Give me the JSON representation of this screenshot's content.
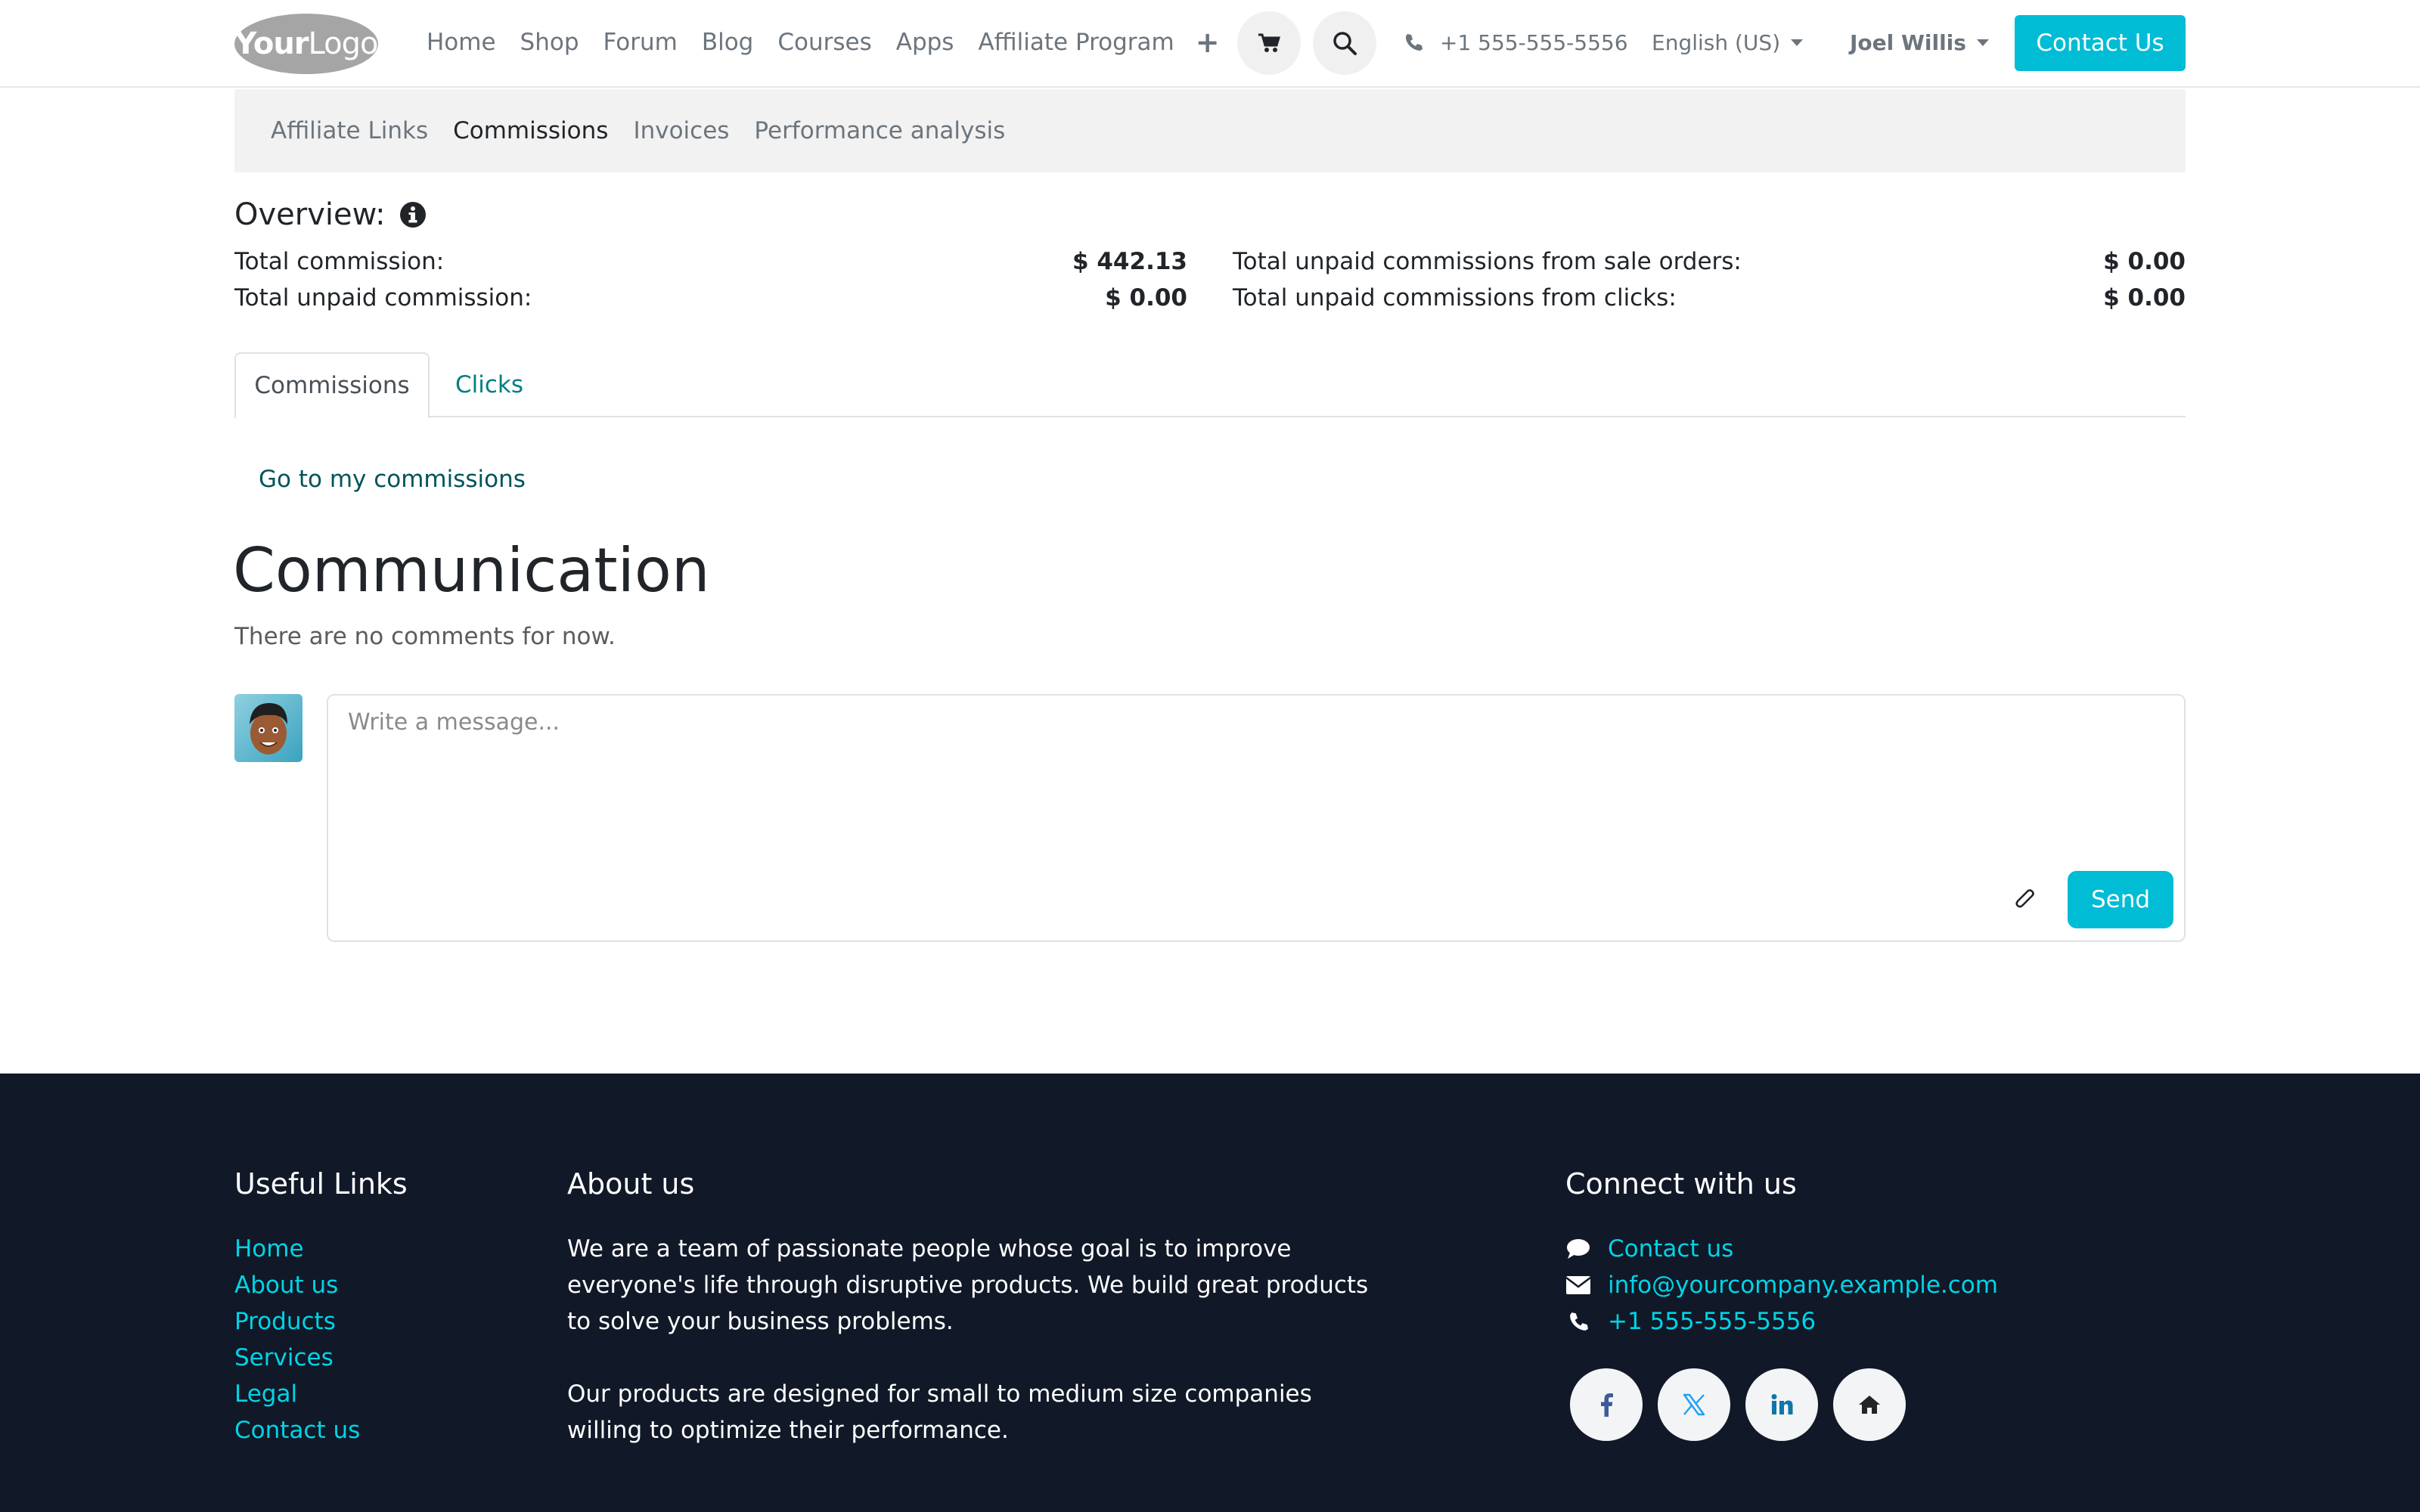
{
  "header": {
    "logo": {
      "part1": "Your",
      "part2": "Logo"
    },
    "nav": [
      "Home",
      "Shop",
      "Forum",
      "Blog",
      "Courses",
      "Apps",
      "Affiliate Program"
    ],
    "phone": "+1 555-555-5556",
    "language": "English (US)",
    "user": "Joel Willis",
    "contact_button": "Contact Us"
  },
  "subnav": [
    "Affiliate Links",
    "Commissions",
    "Invoices",
    "Performance analysis"
  ],
  "overview": {
    "title": "Overview:",
    "rows": [
      {
        "label": "Total commission:",
        "value": "$ 442.13"
      },
      {
        "label": "Total unpaid commission:",
        "value": "$ 0.00"
      },
      {
        "label": "Total unpaid commissions from sale orders:",
        "value": "$ 0.00"
      },
      {
        "label": "Total unpaid commissions from clicks:",
        "value": "$ 0.00"
      }
    ]
  },
  "tabs": {
    "commissions": "Commissions",
    "clicks": "Clicks"
  },
  "go_link": "Go to my commissions",
  "communication": {
    "title": "Communication",
    "empty": "There are no comments for now.",
    "placeholder": "Write a message...",
    "send": "Send"
  },
  "footer": {
    "useful_links": {
      "title": "Useful Links",
      "items": [
        "Home",
        "About us",
        "Products",
        "Services",
        "Legal",
        "Contact us"
      ]
    },
    "about": {
      "title": "About us",
      "p1": "We are a team of passionate people whose goal is to improve everyone's life through disruptive products. We build great products to solve your business problems.",
      "p2": "Our products are designed for small to medium size companies willing to optimize their performance."
    },
    "connect": {
      "title": "Connect with us",
      "contact": "Contact us",
      "email": "info@yourcompany.example.com",
      "phone": "+1 555-555-5556"
    }
  },
  "colors": {
    "accent": "#00bcd4",
    "footer_bg": "#111827",
    "link": "#017e84",
    "footer_link": "#00d4e6"
  }
}
